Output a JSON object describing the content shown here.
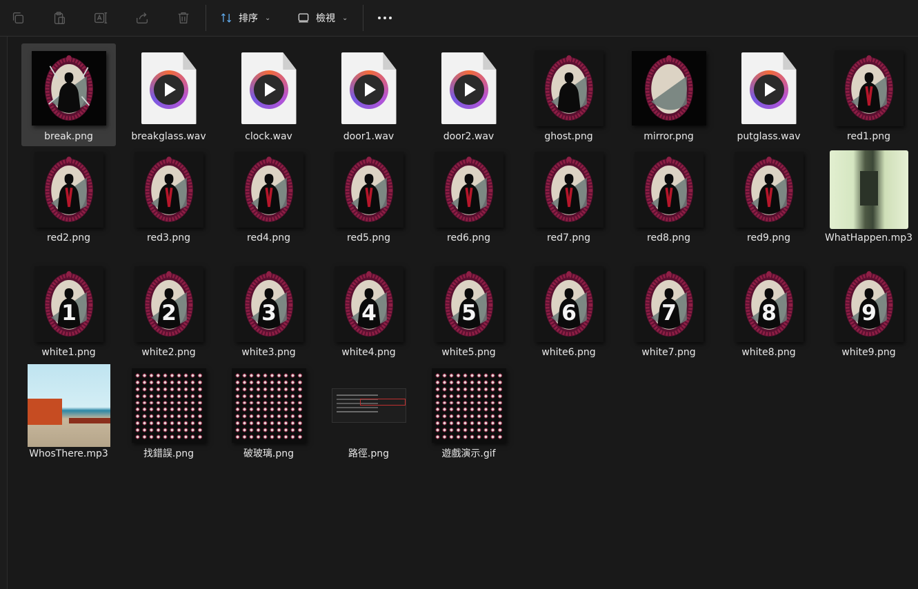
{
  "toolbar": {
    "icons": [
      "copy-icon",
      "paste-icon",
      "rename-icon",
      "share-icon",
      "delete-icon"
    ],
    "sort_label": "排序",
    "view_label": "檢視",
    "more_icon": "more-icon"
  },
  "files": [
    {
      "name": "break.png",
      "kind": "mirror-break",
      "selected": true
    },
    {
      "name": "breakglass.wav",
      "kind": "wav"
    },
    {
      "name": "clock.wav",
      "kind": "wav"
    },
    {
      "name": "door1.wav",
      "kind": "wav"
    },
    {
      "name": "door2.wav",
      "kind": "wav"
    },
    {
      "name": "ghost.png",
      "kind": "mirror-figure"
    },
    {
      "name": "mirror.png",
      "kind": "mirror-empty"
    },
    {
      "name": "putglass.wav",
      "kind": "wav"
    },
    {
      "name": "red1.png",
      "kind": "mirror-red"
    },
    {
      "name": "red2.png",
      "kind": "mirror-red"
    },
    {
      "name": "red3.png",
      "kind": "mirror-red"
    },
    {
      "name": "red4.png",
      "kind": "mirror-red"
    },
    {
      "name": "red5.png",
      "kind": "mirror-red"
    },
    {
      "name": "red6.png",
      "kind": "mirror-red"
    },
    {
      "name": "red7.png",
      "kind": "mirror-red"
    },
    {
      "name": "red8.png",
      "kind": "mirror-red"
    },
    {
      "name": "red9.png",
      "kind": "mirror-red"
    },
    {
      "name": "WhatHappen.mp3",
      "kind": "photo-hall"
    },
    {
      "name": "white1.png",
      "kind": "mirror-white",
      "digit": "1"
    },
    {
      "name": "white2.png",
      "kind": "mirror-white",
      "digit": "2"
    },
    {
      "name": "white3.png",
      "kind": "mirror-white",
      "digit": "3"
    },
    {
      "name": "white4.png",
      "kind": "mirror-white",
      "digit": "4"
    },
    {
      "name": "white5.png",
      "kind": "mirror-white",
      "digit": "5"
    },
    {
      "name": "white6.png",
      "kind": "mirror-white",
      "digit": "6"
    },
    {
      "name": "white7.png",
      "kind": "mirror-white",
      "digit": "7"
    },
    {
      "name": "white8.png",
      "kind": "mirror-white",
      "digit": "8"
    },
    {
      "name": "white9.png",
      "kind": "mirror-white",
      "digit": "9"
    },
    {
      "name": "WhosThere.mp3",
      "kind": "photo-beach"
    },
    {
      "name": "找錯誤.png",
      "kind": "sheet"
    },
    {
      "name": "破玻璃.png",
      "kind": "sheet"
    },
    {
      "name": "路徑.png",
      "kind": "code"
    },
    {
      "name": "遊戲演示.gif",
      "kind": "sheet"
    }
  ],
  "colors": {
    "frame": "#8e1f45",
    "frame_dark": "#5a1030",
    "mirror_glass": "#dcd3c4",
    "mirror_shadow": "#6b7a78",
    "figure": "#0b0b0b",
    "red": "#b4162a"
  }
}
